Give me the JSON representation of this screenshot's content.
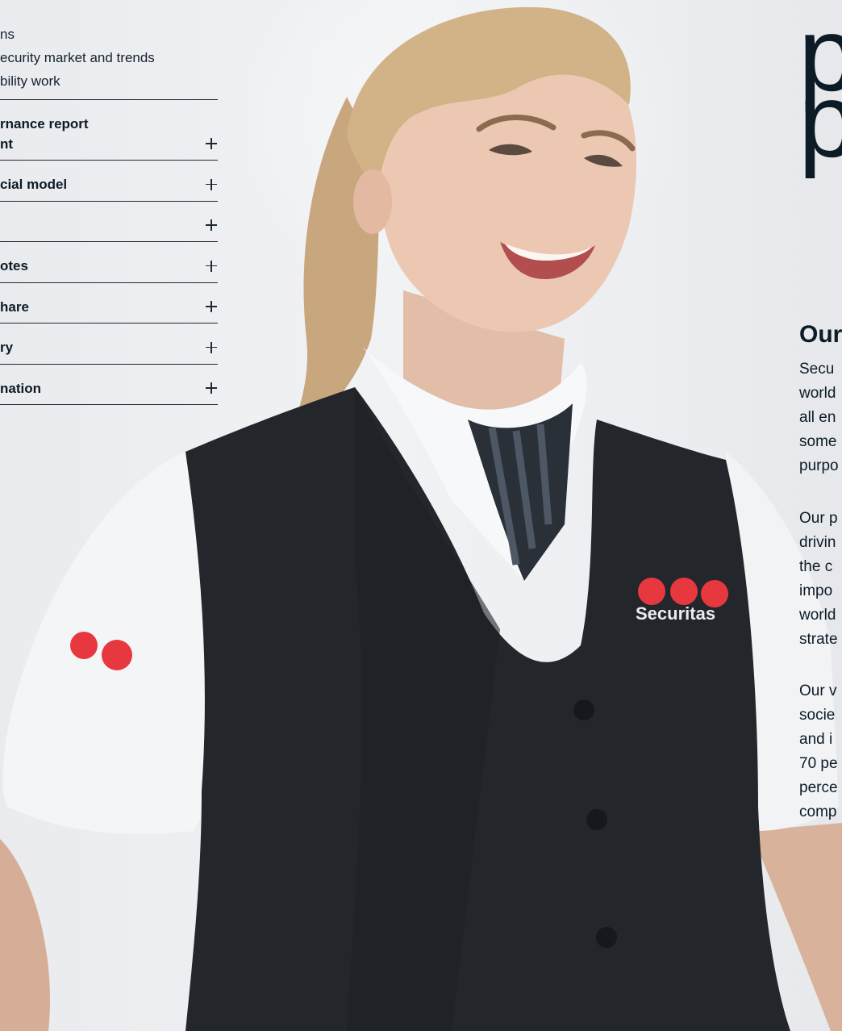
{
  "nav": {
    "sub_items": [
      {
        "label": "ns"
      },
      {
        "label": "ecurity market and trends"
      },
      {
        "label": "bility work"
      }
    ],
    "groups": [
      {
        "label": "rnance report\nnt"
      },
      {
        "label": "cial model"
      },
      {
        "label": ""
      },
      {
        "label": "otes"
      },
      {
        "label": "hare"
      },
      {
        "label": "ry"
      },
      {
        "label": "nation"
      }
    ]
  },
  "headline": {
    "line1": "p",
    "line2": "p"
  },
  "section": {
    "heading": "Our",
    "para1": [
      "Secu",
      "world",
      "all en",
      "some",
      "purpo"
    ],
    "para2": [
      "Our p",
      "drivin",
      "the c",
      "impo",
      "world",
      "strate"
    ],
    "para3": [
      "Our v",
      "socie",
      "and i",
      "70 pe",
      "perce",
      "comp"
    ]
  },
  "photo": {
    "logo_text": "Securitas",
    "brand_red": "#e8383f",
    "vest_color": "#23272c",
    "shirt_color": "#f7f8f9"
  }
}
